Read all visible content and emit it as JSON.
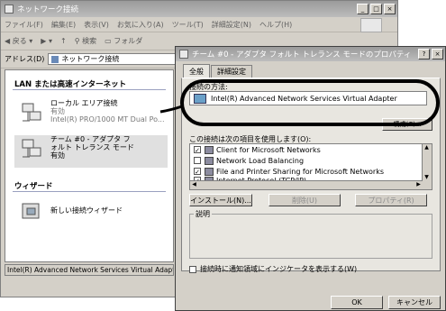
{
  "explorer": {
    "title": "ネットワーク接続",
    "menu": [
      "ファイル(F)",
      "編集(E)",
      "表示(V)",
      "お気に入り(A)",
      "ツール(T)",
      "詳細設定(N)",
      "ヘルプ(H)"
    ],
    "toolbar": {
      "back": "戻る",
      "search": "検索",
      "folders": "フォルダ"
    },
    "address_label": "アドレス(D)",
    "address_value": "ネットワーク接続",
    "section_lan": "LAN または高速インターネット",
    "connections": [
      {
        "name": "ローカル エリア接続",
        "status": "有効",
        "device": "Intel(R) PRO/1000 MT Dual Po..."
      },
      {
        "name": "チーム #0 - アダプタ フォルト トレランス モード",
        "status": "有効"
      }
    ],
    "section_wizard": "ウィザード",
    "wizard_item": "新しい接続ウィザード",
    "status_bar": "Intel(R) Advanced Network Services Virtual Adapte"
  },
  "dialog": {
    "title": "チーム #0 - アダプタ フォルト トレランス モードのプロパティ",
    "tabs": [
      "全般",
      "詳細設定"
    ],
    "connect_using_label": "接続の方法:",
    "adapter_name": "Intel(R) Advanced Network Services Virtual Adapter",
    "configure_button": "構成(C)...",
    "items_label": "この接続は次の項目を使用します(O):",
    "items": [
      {
        "label": "Client for Microsoft Networks",
        "checked": true
      },
      {
        "label": "Network Load Balancing",
        "checked": false
      },
      {
        "label": "File and Printer Sharing for Microsoft Networks",
        "checked": true
      },
      {
        "label": "Internet Protocol (TCP/IP)",
        "checked": true
      }
    ],
    "install_button": "インストール(N)...",
    "uninstall_button": "削除(U)",
    "properties_button": "プロパティ(R)",
    "description_label": "説明",
    "notify_checkbox": "接続時に通知領域にインジケータを表示する(W)",
    "ok_button": "OK",
    "cancel_button": "キャンセル"
  }
}
